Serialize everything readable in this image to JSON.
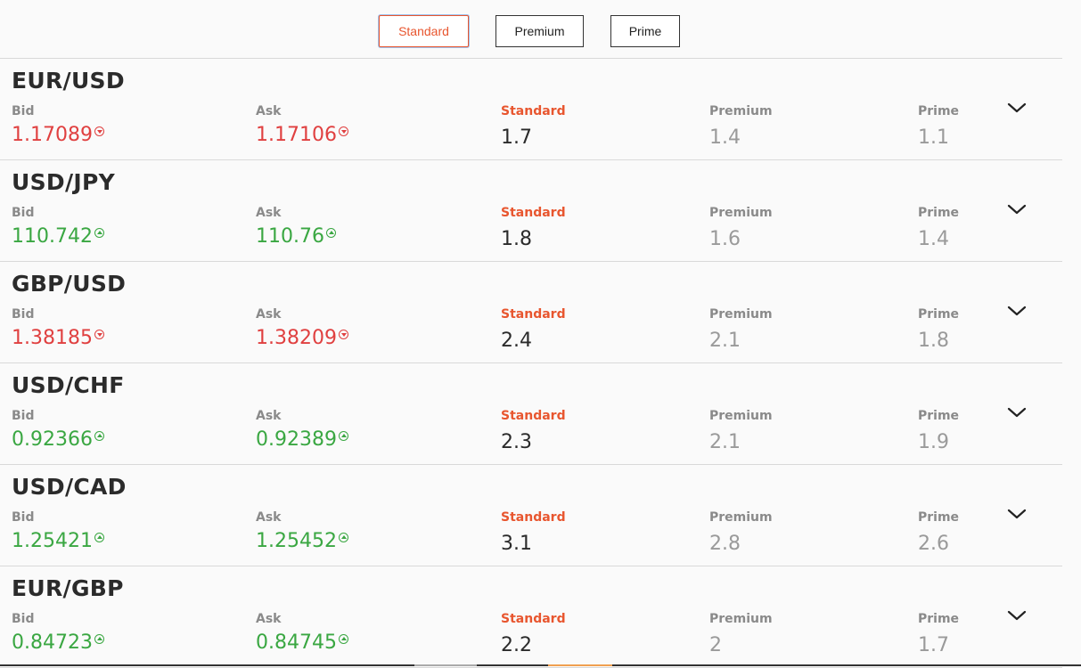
{
  "tabs": [
    "Standard",
    "Premium",
    "Prime"
  ],
  "labels": {
    "bid": "Bid",
    "ask": "Ask",
    "standard": "Standard",
    "premium": "Premium",
    "prime": "Prime"
  },
  "colors": {
    "accent": "#e8562f",
    "up": "#3aa742",
    "down": "#e04040",
    "muted": "#9a9a9a"
  },
  "rows": [
    {
      "pair": "EUR/USD",
      "bid": "1.17089",
      "ask": "1.17106",
      "direction": "down",
      "standard": "1.7",
      "premium": "1.4",
      "prime": "1.1"
    },
    {
      "pair": "USD/JPY",
      "bid": "110.742",
      "ask": "110.76",
      "direction": "up",
      "standard": "1.8",
      "premium": "1.6",
      "prime": "1.4"
    },
    {
      "pair": "GBP/USD",
      "bid": "1.38185",
      "ask": "1.38209",
      "direction": "down",
      "standard": "2.4",
      "premium": "2.1",
      "prime": "1.8"
    },
    {
      "pair": "USD/CHF",
      "bid": "0.92366",
      "ask": "0.92389",
      "direction": "up",
      "standard": "2.3",
      "premium": "2.1",
      "prime": "1.9"
    },
    {
      "pair": "USD/CAD",
      "bid": "1.25421",
      "ask": "1.25452",
      "direction": "up",
      "standard": "3.1",
      "premium": "2.8",
      "prime": "2.6"
    },
    {
      "pair": "EUR/GBP",
      "bid": "0.84723",
      "ask": "0.84745",
      "direction": "up",
      "standard": "2.2",
      "premium": "2",
      "prime": "1.7"
    }
  ],
  "icons": {
    "expand": "chevron-down-icon",
    "trend_up": "arrow-up-circle-icon",
    "trend_down": "arrow-down-circle-icon"
  }
}
